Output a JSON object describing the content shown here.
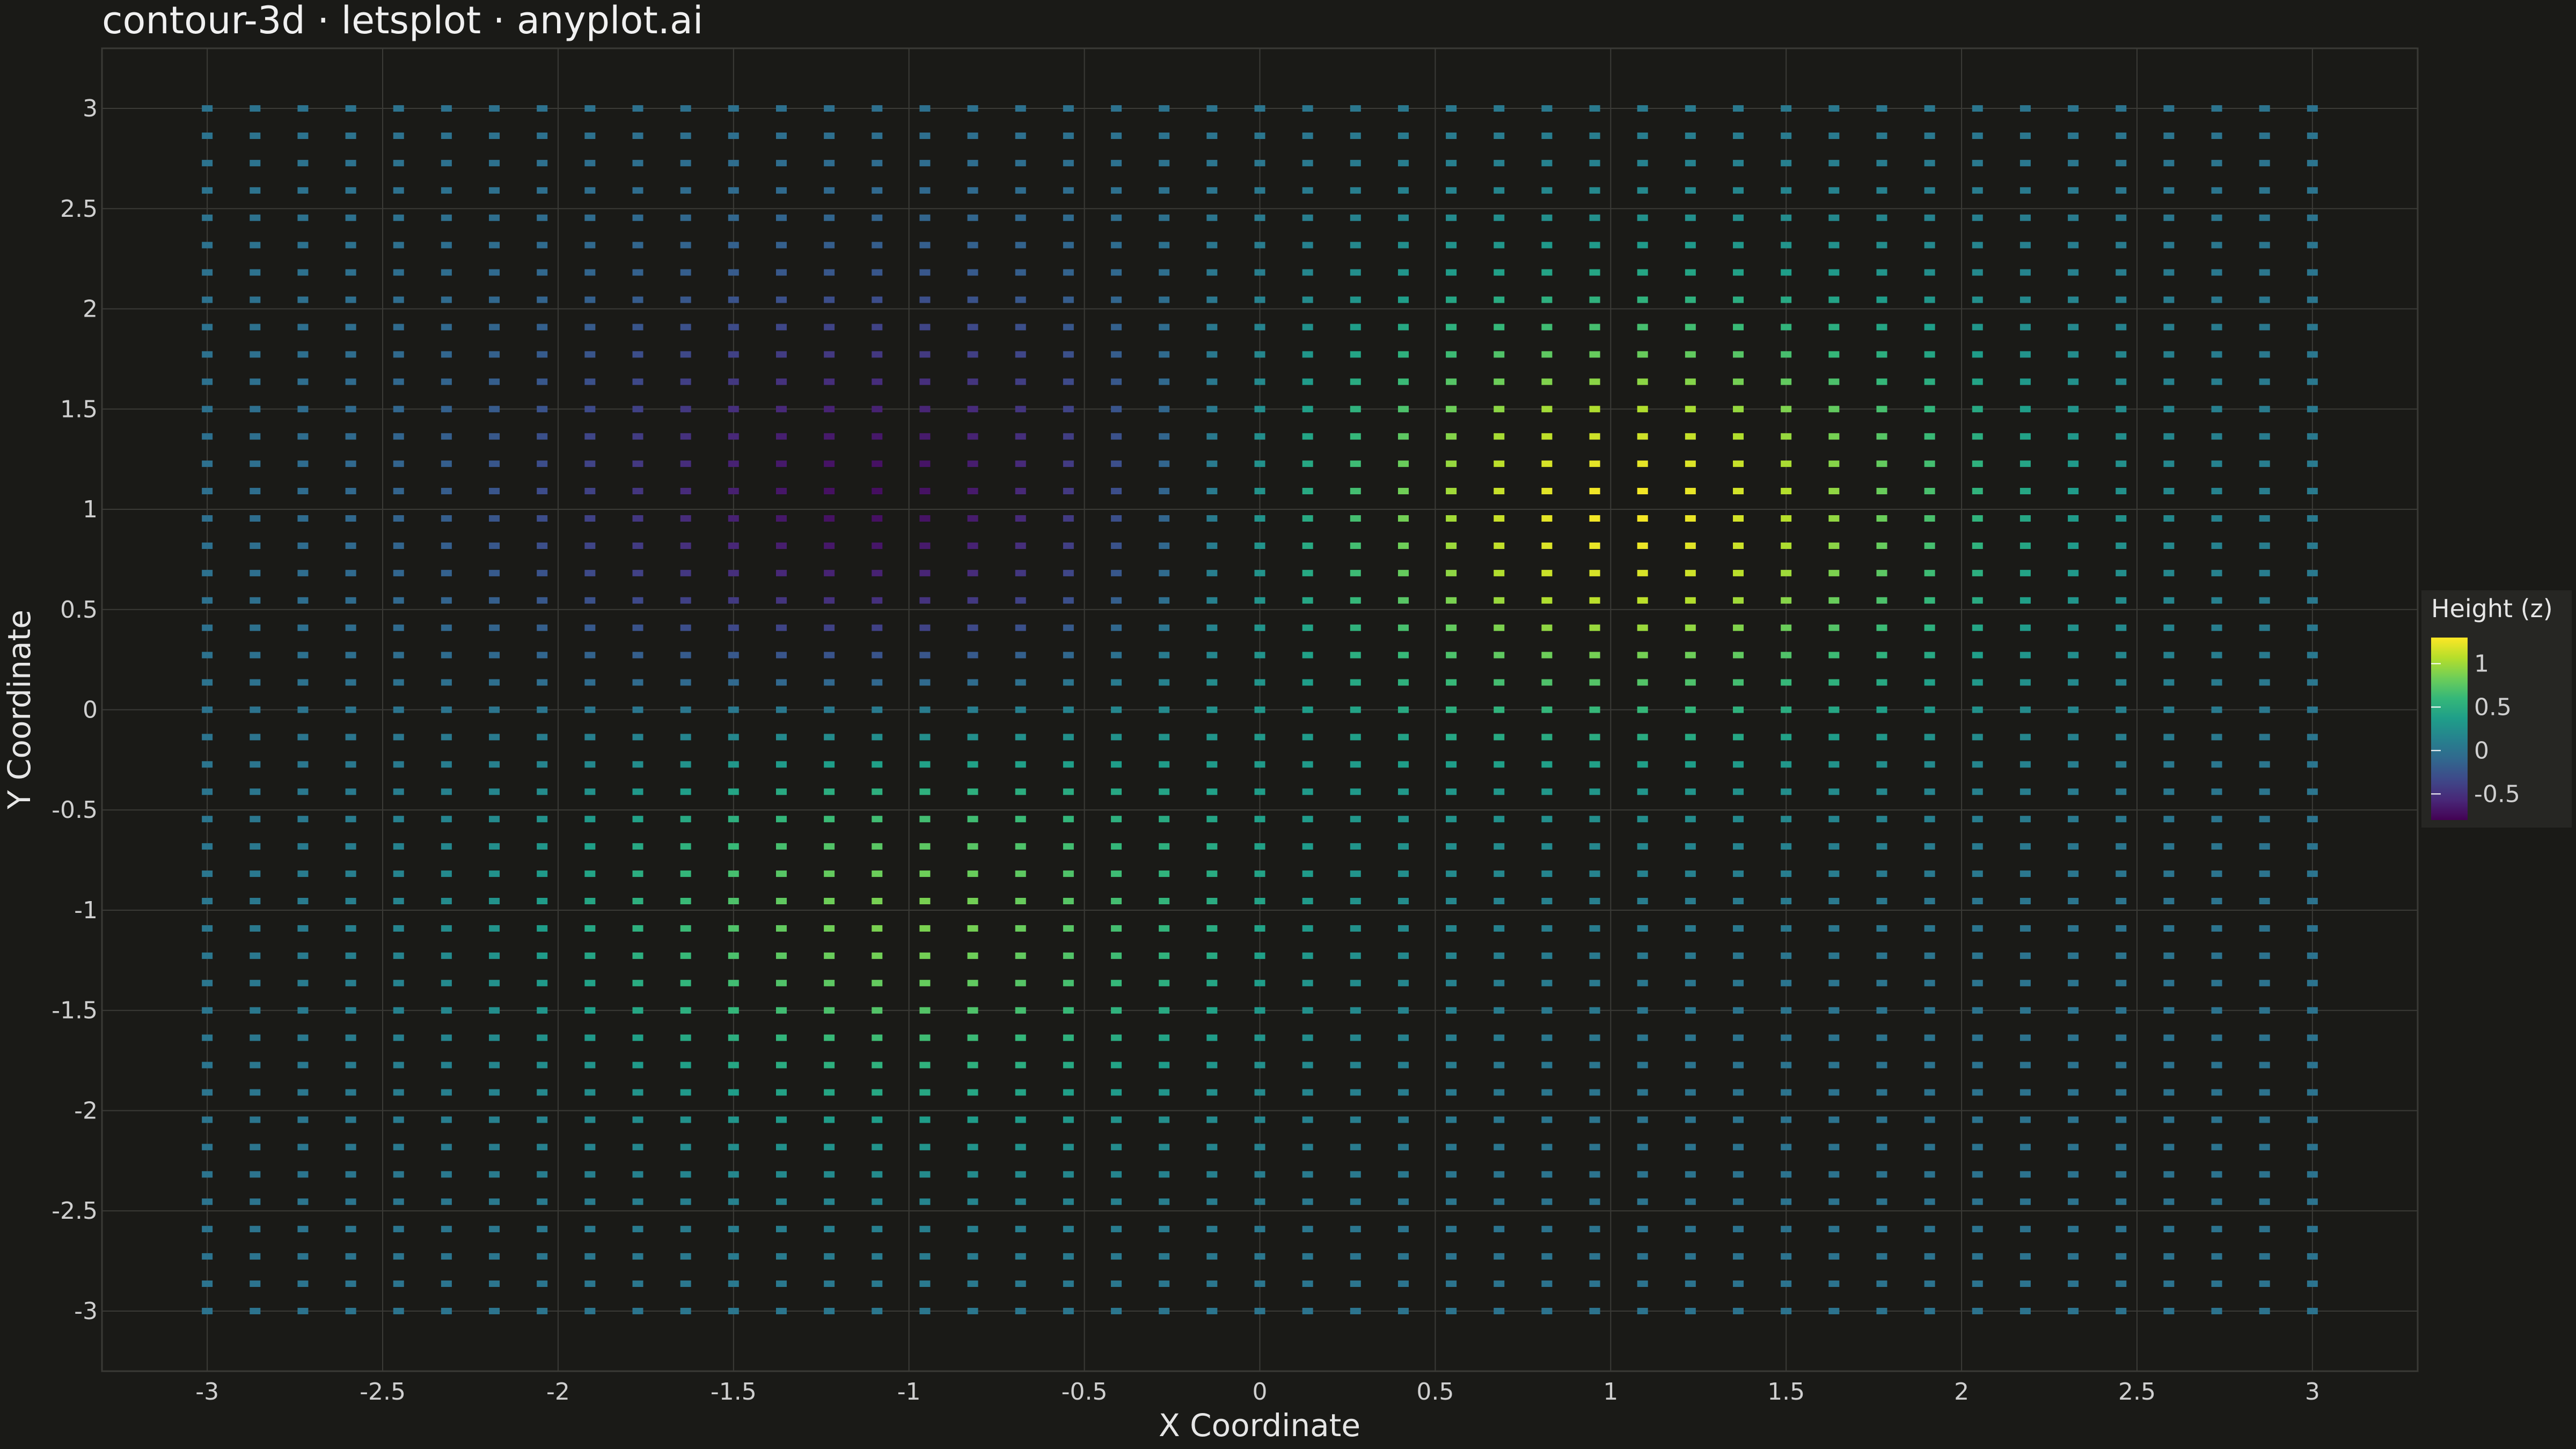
{
  "chart_data": {
    "type": "heatmap",
    "title": "contour-3d · letsplot · anyplot.ai",
    "xlabel": "X Coordinate",
    "ylabel": "Y Coordinate",
    "xlim": [
      -3.3,
      3.3
    ],
    "ylim": [
      -3.3,
      3.3
    ],
    "x_ticks": [
      -3,
      -2.5,
      -2,
      -1.5,
      -1,
      -0.5,
      0,
      0.5,
      1,
      1.5,
      2,
      2.5,
      3
    ],
    "y_ticks": [
      -3,
      -2.5,
      -2,
      -1.5,
      -1,
      -0.5,
      0,
      0.5,
      1,
      1.5,
      2,
      2.5,
      3
    ],
    "x_tick_labels": [
      "-3",
      "-2.5",
      "-2",
      "-1.5",
      "-1",
      "-0.5",
      "0",
      "0.5",
      "1",
      "1.5",
      "2",
      "2.5",
      "3"
    ],
    "y_tick_labels": [
      "-3",
      "-2.5",
      "-2",
      "-1.5",
      "-1",
      "-0.5",
      "0",
      "0.5",
      "1",
      "1.5",
      "2",
      "2.5",
      "3"
    ],
    "grid": true,
    "grid_points": {
      "x_min": -3,
      "x_max": 3,
      "y_min": -3,
      "y_max": 3,
      "count_x": 45,
      "count_y": 45
    },
    "surface": {
      "peaks": [
        {
          "x": 1.0,
          "y": 1.0,
          "amplitude": 1.3,
          "spread": 1.3
        },
        {
          "x": -1.0,
          "y": -1.0,
          "amplitude": 0.9,
          "spread": 1.2
        }
      ],
      "troughs": [
        {
          "x": -1.0,
          "y": 1.0,
          "amplitude": 0.8,
          "spread": 1.2
        }
      ]
    },
    "z_range": [
      -0.8,
      1.3
    ],
    "legend": {
      "title": "Height (z)",
      "position": "right",
      "ticks": [
        1,
        0.5,
        0,
        -0.5
      ],
      "tick_labels": [
        "1",
        "0.5",
        "0",
        "-0.5"
      ]
    },
    "colormap": [
      "#440154",
      "#482878",
      "#3e4989",
      "#31688e",
      "#26828e",
      "#1f9e89",
      "#35b779",
      "#6ece58",
      "#b5de2b",
      "#fde725"
    ]
  },
  "colors": {
    "background": "#1a1a17",
    "panel_border": "#3a3a36",
    "grid": "#3b3b37",
    "legend_bg": "#262623"
  }
}
